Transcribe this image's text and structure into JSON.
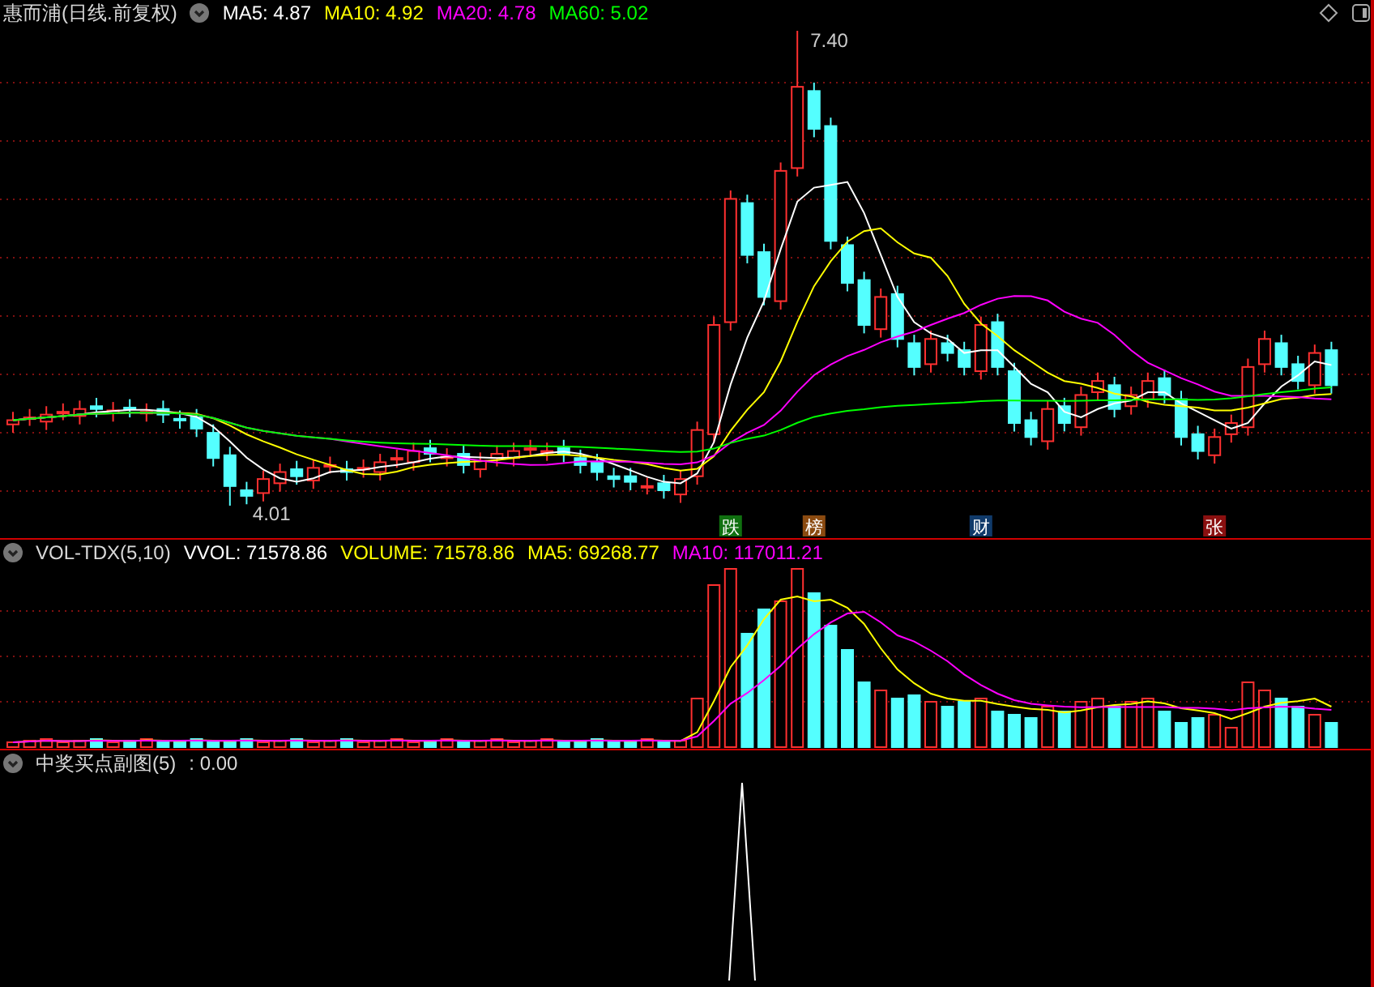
{
  "price_panel": {
    "title": "惠而浦(日线.前复权)",
    "indicators": [
      {
        "label": "MA5: 4.87",
        "color": "#ffffff"
      },
      {
        "label": "MA10: 4.92",
        "color": "#ffff00"
      },
      {
        "label": "MA20: 4.78",
        "color": "#ff00ff"
      },
      {
        "label": "MA60: 5.02",
        "color": "#00ff00"
      }
    ],
    "high_label": "7.40",
    "low_label": "4.01",
    "signal_tags": [
      {
        "text": "跌",
        "color": "#107010"
      },
      {
        "text": "榜",
        "color": "#8a4a10"
      },
      {
        "text": "财",
        "color": "#103a6a"
      },
      {
        "text": "张",
        "color": "#8a1010"
      }
    ]
  },
  "volume_panel": {
    "title": "VOL-TDX(5,10)",
    "indicators": [
      {
        "label": "VVOL: 71578.86",
        "color": "#ffffff"
      },
      {
        "label": "VOLUME: 71578.86",
        "color": "#ffff00"
      },
      {
        "label": "MA5: 69268.77",
        "color": "#ffff00"
      },
      {
        "label": "MA10: 117011.21",
        "color": "#ff00ff"
      }
    ]
  },
  "indicator_panel": {
    "title": "中奖买点副图(5)",
    "value": ": 0.00"
  }
}
